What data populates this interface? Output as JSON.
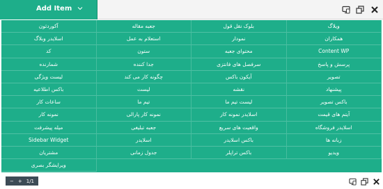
{
  "toolbar": {
    "add_item_label": "Add Item",
    "icons": [
      "chevron-down-icon",
      "responsive-icon",
      "resize-icon",
      "close-icon"
    ]
  },
  "grid": [
    [
      "ویلاگ",
      "بلوک نقل قول",
      "جعبه مقاله",
      "آکوردئون"
    ],
    [
      "همکاران",
      "نمودار",
      "استعلام به عمل",
      "اسلایدر وبلاگ"
    ],
    [
      "Content WP",
      "محتوای جعبه",
      "ستون",
      "کد"
    ],
    [
      "پرسش و پاسخ",
      "سرفصل های فانتزی",
      "جدا کننده",
      "شمارنده"
    ],
    [
      "تصویر",
      "آیکون باکس",
      "چگونه کار می کند",
      "لیست ویژگی"
    ],
    [
      "پیشنهاد",
      "نقشه",
      "لیست",
      "باکس اطلاعیه"
    ],
    [
      "باکس تصویر",
      "لیست تیم ما",
      "تیم ما",
      "ساعات کار"
    ],
    [
      "آیتم های قیمت",
      "اسلایدر نمونه کار",
      "نمونه کار پارالی",
      "نمونه کار"
    ],
    [
      "اسلایدر فروشگاه",
      "واقعیت های سریع",
      "جعبه تبلیغی",
      "میله پیشرفت"
    ],
    [
      "زبانه ها",
      "باکس اسلایدر",
      "اسلایدر",
      "Sidebar Widget"
    ],
    [
      "ویدیو",
      "باکس تراپلر",
      "جدول زمانی",
      "مشتریان"
    ],
    [
      "",
      "",
      "",
      "ویرایشگر بصری"
    ]
  ],
  "bottombar": {
    "minus_label": "−",
    "plus_label": "+",
    "page_label": "1/1",
    "icons": [
      "responsive-icon",
      "resize-icon",
      "close-icon"
    ]
  }
}
